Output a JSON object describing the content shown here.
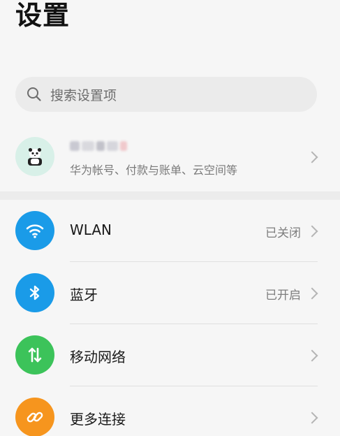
{
  "header": {
    "title": "设置"
  },
  "search": {
    "placeholder": "搜索设置项"
  },
  "account": {
    "subtitle": "华为帐号、付款与账单、云空间等"
  },
  "settings": [
    {
      "label": "WLAN",
      "status": "已关闭",
      "icon": "wifi-icon",
      "color": "#1a9be8"
    },
    {
      "label": "蓝牙",
      "status": "已开启",
      "icon": "bluetooth-icon",
      "color": "#1a9be8"
    },
    {
      "label": "移动网络",
      "status": "",
      "icon": "mobile-data-icon",
      "color": "#3cc35a"
    },
    {
      "label": "更多连接",
      "status": "",
      "icon": "link-icon",
      "color": "#f6951e"
    }
  ]
}
